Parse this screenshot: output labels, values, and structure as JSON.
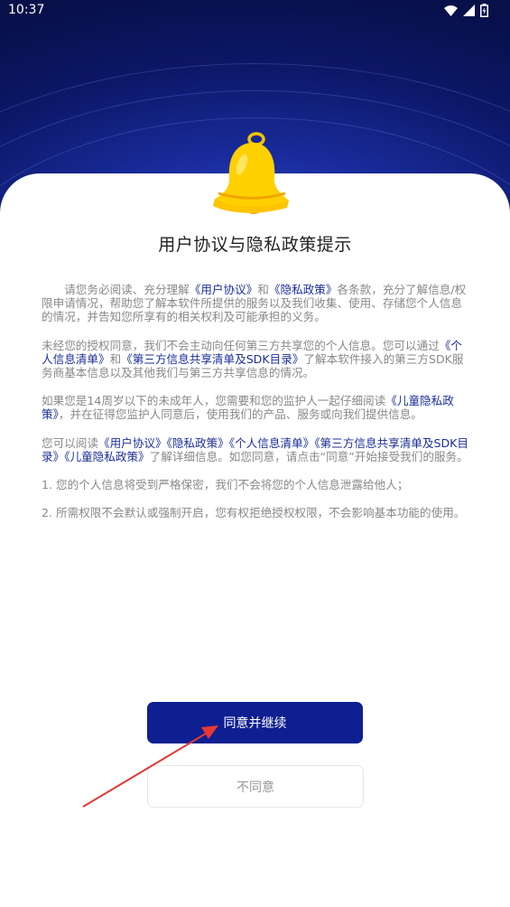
{
  "status_bar": {
    "time": "10:37",
    "icons": [
      "wifi-icon",
      "signal-icon",
      "battery-icon"
    ]
  },
  "dialog": {
    "title": "用户协议与隐私政策提示",
    "p1": {
      "t1": "请您务必阅读、充分理解",
      "l1": "《用户协议》",
      "t2": "和",
      "l2": "《隐私政策》",
      "t3": "各条款，充分了解信息/权限申请情况，帮助您了解本软件所提供的服务以及我们收集、使用、存储您个人信息的情况，并告知您所享有的相关权利及可能承担的义务。"
    },
    "p2": {
      "t1": "未经您的授权同意，我们不会主动向任何第三方共享您的个人信息。您可以通过",
      "l1": "《个人信息清单》",
      "t2": "和",
      "l2": "《第三方信息共享清单及SDK目录》",
      "t3": "了解本软件接入的第三方SDK服务商基本信息以及其他我们与第三方共享信息的情况。"
    },
    "p3": {
      "t1": "如果您是14周岁以下的未成年人，您需要和您的监护人一起仔细阅读",
      "l1": "《儿童隐私政策》",
      "t2": "，并在征得您监护人同意后，使用我们的产品、服务或向我们提供信息。"
    },
    "p4": {
      "t1": "您可以阅读",
      "l1": "《用户协议》",
      "l2": "《隐私政策》",
      "l3": "《个人信息清单》",
      "l4": "《第三方信息共享清单及SDK目录》",
      "l5": "《儿童隐私政策》",
      "t2": "了解详细信息。如您同意，请点击“同意”开始接受我们的服务。"
    },
    "p5": "1. 您的个人信息将受到严格保密，我们不会将您的个人信息泄露给他人；",
    "p6": "2. 所需权限不会默认或强制开启，您有权拒绝授权权限，不会影响基本功能的使用。",
    "agree_label": "同意并继续",
    "disagree_label": "不同意"
  },
  "colors": {
    "header_dark": "#071049",
    "header_light": "#2f4dd0",
    "link": "#1b2f9a",
    "agree_button": "#0e1f92",
    "body_text": "#888888",
    "bell": "#ffd000",
    "annotation_arrow": "#e53935"
  }
}
